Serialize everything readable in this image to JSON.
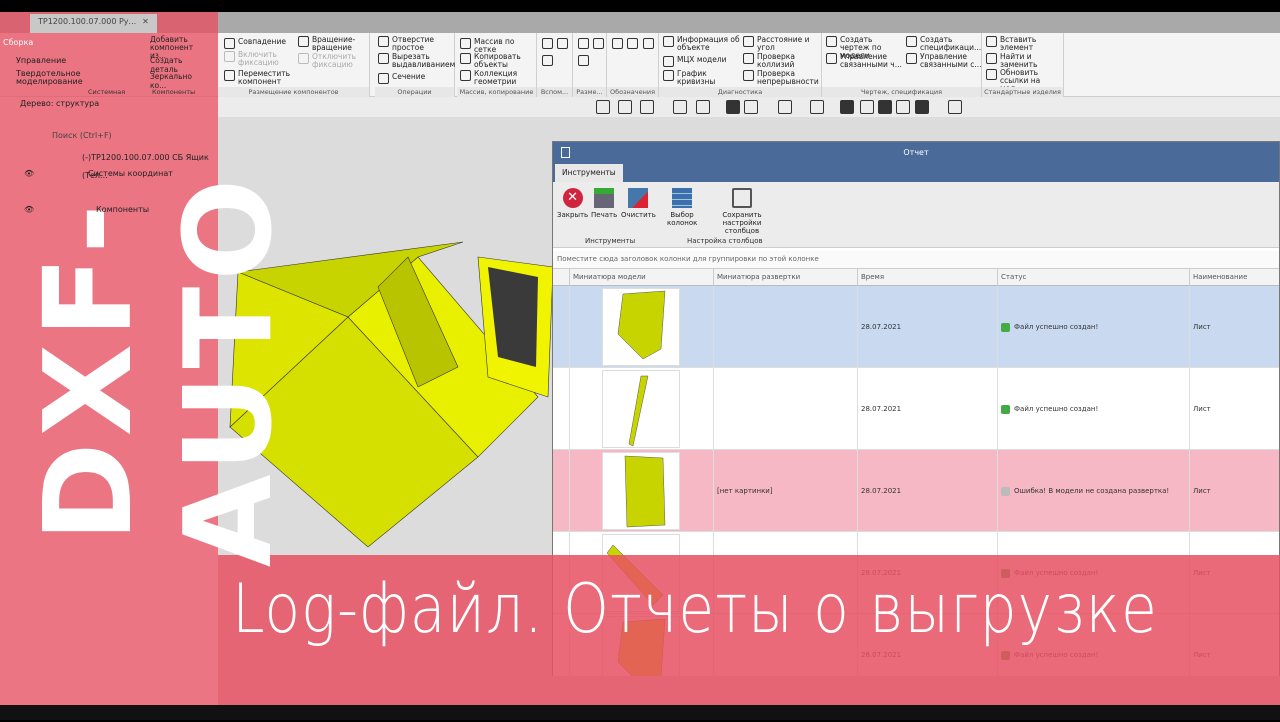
{
  "tabs": {
    "document": "ТР1200.100.07.000 Ру..."
  },
  "sidebar_modes": [
    "Сборка",
    "Управление",
    "Твердотельное моделирование"
  ],
  "ribbon": {
    "groups": [
      "Системная",
      "Компоненты",
      "Размещение компонентов",
      "Операции",
      "Массив, копирование",
      "Вспом...",
      "Разме...",
      "Обозначения",
      "Диагностика",
      "Чертеж, спецификация",
      "Стандартные изделия"
    ],
    "components": [
      "Добавить компонент из...",
      "Создать деталь",
      "Зеркально ко..."
    ],
    "placement": [
      "Совпадение",
      "Включить фиксацию",
      "Переместить компонент",
      "Вращение-вращение",
      "Отключить фиксацию"
    ],
    "operations": [
      "Отверстие простое",
      "Вырезать выдавливанием",
      "Сечение"
    ],
    "array": [
      "Массив по сетке",
      "Копировать объекты",
      "Коллекция геометрии"
    ],
    "diagnostics": [
      "Информация об объекте",
      "МЦХ модели",
      "График кривизны",
      "Расстояние и угол",
      "Проверка коллизий",
      "Проверка непрерывности"
    ],
    "drawing": [
      "Создать чертеж по модели",
      "Управление связанными ч...",
      "Создать спецификаци...",
      "Управление связанными с..."
    ],
    "standard": [
      "Вставить элемент",
      "Найти и заменить",
      "Обновить ссылки на мод..."
    ]
  },
  "tree": {
    "title": "Дерево: структура",
    "search_placeholder": "Поиск (Ctrl+F)",
    "items": [
      "(-)ТР1200.100.07.000 СБ Ящик (Тел...",
      "Системы координат",
      "Компоненты"
    ]
  },
  "report": {
    "title": "Отчет",
    "tab": "Инструменты",
    "buttons": [
      "Закрыть",
      "Печать",
      "Очистить",
      "Выбор колонок",
      "Сохранить настройки столбцов"
    ],
    "group_labels": [
      "Инструменты",
      "Настройка столбцов"
    ],
    "group_hint": "Поместите сюда заголовок колонки для группировки по этой колонке",
    "columns": [
      "Миниатюра модели",
      "Миниатюра развертки",
      "Время",
      "Статус",
      "Наименование"
    ],
    "rows": [
      {
        "unfold": "",
        "time": "28.07.2021",
        "status": "Файл успешно создан!",
        "name": "Лист",
        "state": "selected"
      },
      {
        "unfold": "",
        "time": "28.07.2021",
        "status": "Файл успешно создан!",
        "name": "Лист",
        "state": "ok"
      },
      {
        "unfold": "[нет картинки]",
        "time": "28.07.2021",
        "status": "Ошибка! В модели не создана развертка!",
        "name": "Лист",
        "state": "error"
      },
      {
        "unfold": "",
        "time": "28.07.2021",
        "status": "Файл успешно создан!",
        "name": "Лист",
        "state": "ok"
      },
      {
        "unfold": "",
        "time": "28.07.2021",
        "status": "Файл успешно создан!",
        "name": "Лист",
        "state": "ok"
      }
    ]
  },
  "overlay": {
    "logo": "DXF-AUTO",
    "title": "Log-файл. Отчеты о выгрузке"
  },
  "colors": {
    "overlay_red": "#e85062",
    "report_title": "#4a6a99",
    "row_selected": "#c9d9f0",
    "row_error": "#f5b8c4",
    "model": "#c8d400"
  }
}
